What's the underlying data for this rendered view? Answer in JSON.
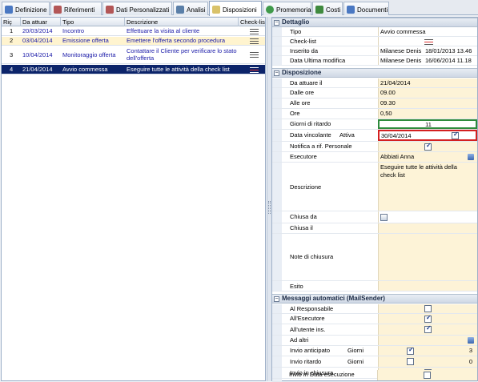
{
  "tabs": [
    {
      "label": "Definizione",
      "icon": "definition-icon",
      "color": "#4a78c2"
    },
    {
      "label": "Riferimenti",
      "icon": "users-icon",
      "color": "#b35656"
    },
    {
      "label": "Dati Personalizzati",
      "icon": "users-icon",
      "color": "#b35656"
    },
    {
      "label": "Analisi",
      "icon": "list-icon",
      "color": "#5a7fa8"
    },
    {
      "label": "Disposizioni",
      "icon": "document-icon",
      "color": "#d9c26a"
    },
    {
      "label": "Promemoria",
      "icon": "reminder-icon",
      "color": "#3f9a4a"
    },
    {
      "label": "Costi",
      "icon": "money-icon",
      "color": "#3f8a3f"
    },
    {
      "label": "Documenti",
      "icon": "folder-icon",
      "color": "#4a78c2"
    }
  ],
  "grid": {
    "headers": [
      "Riç",
      "Da attuar",
      "Tipo",
      "Descrizione",
      "Check-list"
    ],
    "rows": [
      {
        "n": "1",
        "date": "20/03/2014",
        "tipo": "Incontro",
        "desc": "Effettuare la visita al cliente",
        "bg": "#fff"
      },
      {
        "n": "2",
        "date": "03/04/2014",
        "tipo": "Emissione offerta",
        "desc": "Emettere l'offerta secondo procedura",
        "bg": "#fff4cf"
      },
      {
        "n": "3",
        "date": "10/04/2014",
        "tipo": "Monitoraggio offerta",
        "desc": "Contattare il Cliente per verificare lo stato dell'offerta",
        "bg": "#fff"
      },
      {
        "n": "4",
        "date": "21/04/2014",
        "tipo": "Avvio commessa",
        "desc": "Eseguire tutte le attività della check list",
        "bg": "#0c246a"
      }
    ]
  },
  "detail": {
    "sections": {
      "dettaglio": "Dettaglio",
      "disposizione": "Disposizione",
      "messaggi": "Messaggi automatici (MailSender)"
    },
    "dettaglio_rows": [
      {
        "label": "Tipo",
        "value": "Avvio commessa"
      },
      {
        "label": "Check-list",
        "value": ""
      },
      {
        "label": "Inserito da",
        "value": "Milanese Denis",
        "value2": "18/01/2013 13.46"
      },
      {
        "label": "Data Ultima modifica",
        "value": "Milanese Denis",
        "value2": "16/06/2014 11.18"
      }
    ],
    "disposizione_rows": [
      {
        "label": "Da attuare il",
        "value": "21/04/2014"
      },
      {
        "label": "Dalle ore",
        "value": "09.00"
      },
      {
        "label": "Alle ore",
        "value": "09.30"
      },
      {
        "label": "Ore",
        "value": "0,50"
      },
      {
        "label": "Giorni di ritardo",
        "value": "11"
      },
      {
        "label": "Data vincolante",
        "value": "30/04/2014",
        "label2": "Attiva"
      },
      {
        "label": "Notifica a rif. Personale",
        "value": ""
      },
      {
        "label": "Esecutore",
        "value": "Abbiati Anna"
      },
      {
        "label": "Descrizione",
        "value": "Eseguire tutte le attività della check list"
      },
      {
        "label": "Chiusa da",
        "value": ""
      },
      {
        "label": "Chiusa il",
        "value": ""
      },
      {
        "label": "Note di chiusura",
        "value": ""
      },
      {
        "label": "Esito",
        "value": ""
      }
    ],
    "messaggi_rows": [
      {
        "label": "Al Responsabile"
      },
      {
        "label": "All'Esecutore"
      },
      {
        "label": "All'utente ins."
      },
      {
        "label": "Ad altri"
      },
      {
        "label": "Invio anticipato",
        "label2": "Giorni",
        "num": "3"
      },
      {
        "label": "Invio ritardo",
        "label2": "Giorni",
        "num": "0"
      },
      {
        "label": "Invio in chiusura"
      },
      {
        "label": "Invio in Data esecuzione"
      }
    ],
    "highlight": {
      "giorni_ritardo_border": "#2e8b3c",
      "data_vincolante_border": "#d42020"
    }
  },
  "colors": {
    "selected_row": "#0c246a",
    "value_bg": "#fdf3d7",
    "row_link_text": "#1a1aa8"
  }
}
